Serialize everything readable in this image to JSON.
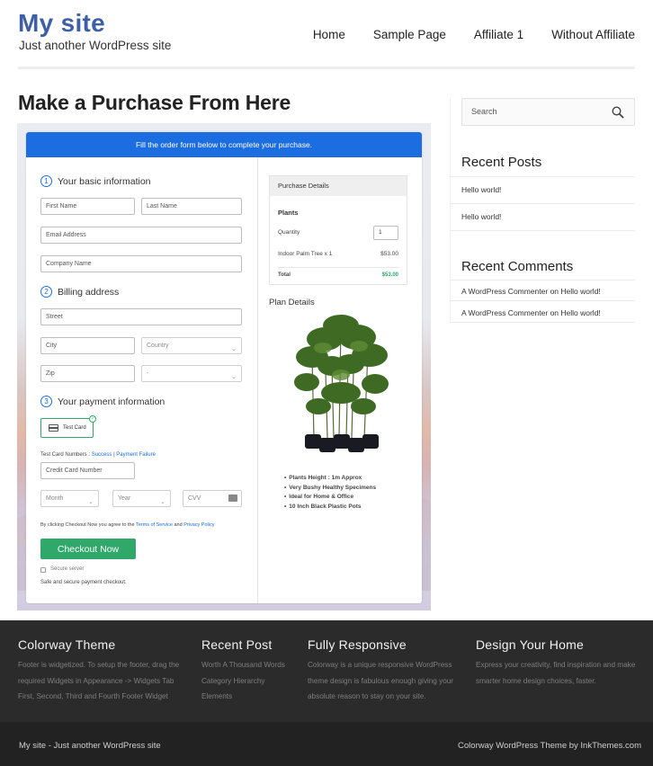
{
  "header": {
    "site_title": "My site",
    "tagline": "Just another WordPress site",
    "nav": [
      "Home",
      "Sample Page",
      "Affiliate 1",
      "Without Affiliate"
    ]
  },
  "main": {
    "page_title": "Make a Purchase From Here",
    "form": {
      "banner": "Fill the order form below to complete your purchase.",
      "step1": {
        "num": "1",
        "label": "Your basic information"
      },
      "step2": {
        "num": "2",
        "label": "Billing address"
      },
      "step3": {
        "num": "3",
        "label": "Your payment information"
      },
      "first_name": "First Name",
      "last_name": "Last Name",
      "email": "Email Address",
      "company": "Company Name",
      "street": "Street",
      "city": "City",
      "country": "Country",
      "zip": "Zip",
      "state": "-",
      "card_option": "Test Card",
      "test_numbers_prefix": "Test Card Numbers :",
      "success_link": "Success",
      "separator": "|",
      "failure_link": "Payment Failure",
      "card_number": "Credit Card Number",
      "month": "Month",
      "year": "Year",
      "cvv": "CVV",
      "terms_prefix": "By clicking Checkout Now you agree to the",
      "terms_link": "Terms of Service",
      "terms_and": "and",
      "privacy_link": "Privacy Policy",
      "checkout_button": "Checkout Now",
      "secure": "Secure server",
      "safe_note": "Safe and secure payment checkout."
    },
    "purchase": {
      "header": "Purchase Details",
      "product": "Plants",
      "quantity_label": "Quantity",
      "quantity_value": "1",
      "item": "Indoor Palm Tree x 1",
      "item_price": "$53.00",
      "total_label": "Total",
      "total_value": "$53.00",
      "total_color": "#2fa86a"
    },
    "plan": {
      "title": "Plan Details",
      "bullets": [
        "Plants Height : 1m Approx",
        "Very Bushy Healthy Specimens",
        "Ideal for Home & Office",
        "10 Inch Black Plastic Pots"
      ]
    }
  },
  "sidebar": {
    "search_placeholder": "Search",
    "recent_posts_title": "Recent Posts",
    "recent_posts": [
      "Hello world!",
      "Hello world!"
    ],
    "recent_comments_title": "Recent Comments",
    "recent_comments": [
      "A WordPress Commenter on Hello world!",
      "A WordPress Commenter on Hello world!"
    ]
  },
  "footer": {
    "col1": {
      "title": "Colorway Theme",
      "lines": [
        "Footer is widgetized. To setup the footer, drag the",
        "required Widgets in Appearance -> Widgets Tab",
        "First, Second, Third and Fourth Footer Widget"
      ]
    },
    "col2": {
      "title": "Recent Post",
      "lines": [
        "Worth A Thousand Words",
        "Category Hierarchy",
        "Elements"
      ]
    },
    "col3": {
      "title": "Fully Responsive",
      "lines": [
        "Colorway is a unique responsive WordPress",
        "theme design is fabulous enough giving your",
        "absolute reason to stay on your site."
      ]
    },
    "col4": {
      "title": "Design Your Home",
      "lines": [
        "Express your creativity, find inspiration and make",
        "smarter home design choices, faster."
      ]
    },
    "bottom_left": "My site - Just another WordPress site",
    "bottom_right": "Colorway WordPress Theme by InkThemes.com"
  },
  "colors": {
    "brand": "#3d5fa6",
    "accent": "#1c6de0",
    "checkout": "#2fa86a",
    "footer": "#2b2b2b"
  }
}
